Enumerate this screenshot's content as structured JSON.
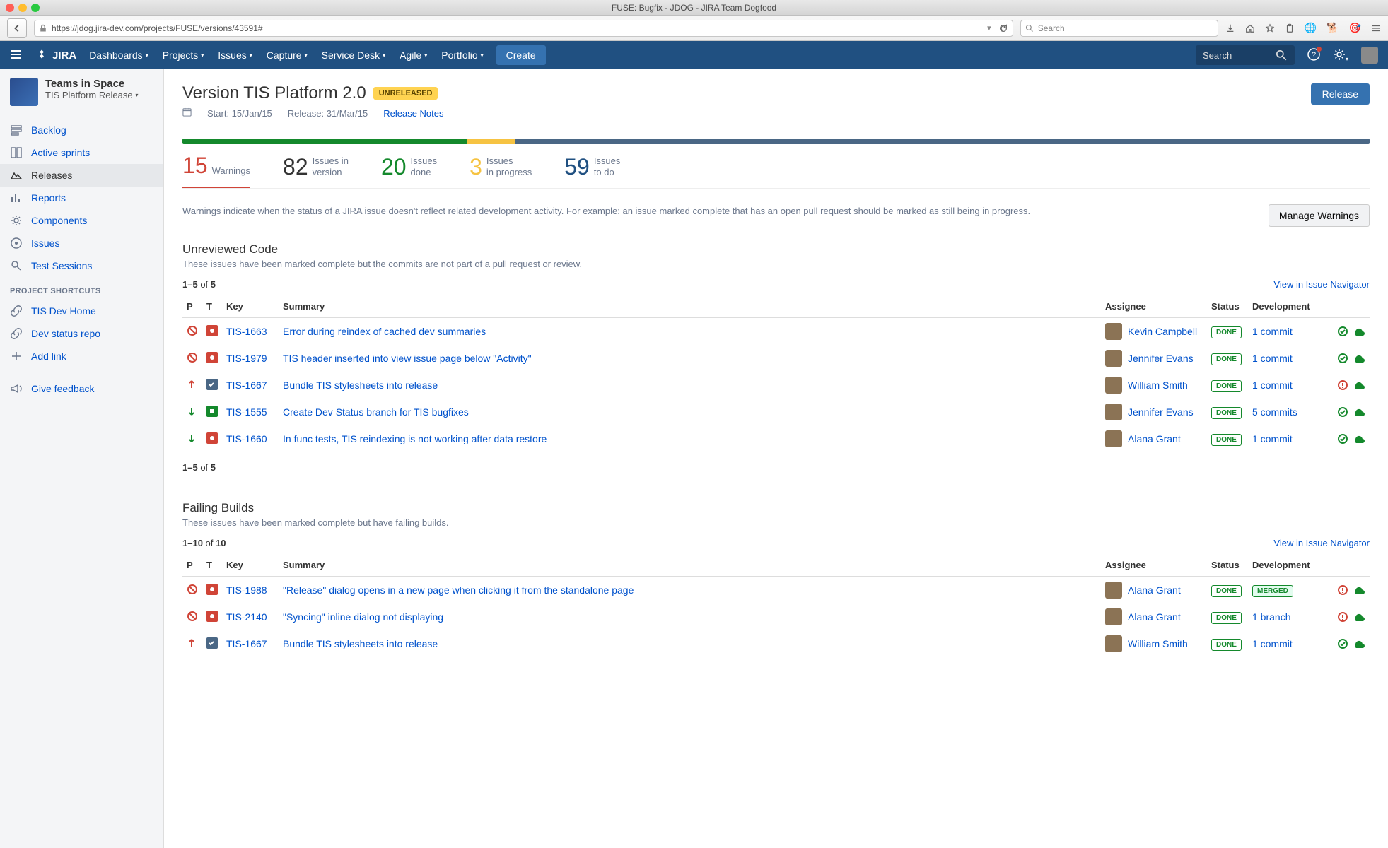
{
  "browser": {
    "title": "FUSE: Bugfix - JDOG - JIRA Team Dogfood",
    "url": "https://jdog.jira-dev.com/projects/FUSE/versions/43591#",
    "search_placeholder": "Search"
  },
  "jira_nav": {
    "items": [
      "Dashboards",
      "Projects",
      "Issues",
      "Capture",
      "Service Desk",
      "Agile",
      "Portfolio"
    ],
    "create": "Create",
    "search_placeholder": "Search"
  },
  "sidebar": {
    "project_name": "Teams in Space",
    "release_name": "TIS Platform Release",
    "nav": [
      {
        "icon": "backlog",
        "label": "Backlog"
      },
      {
        "icon": "sprints",
        "label": "Active sprints"
      },
      {
        "icon": "releases",
        "label": "Releases",
        "active": true
      },
      {
        "icon": "reports",
        "label": "Reports"
      },
      {
        "icon": "components",
        "label": "Components"
      },
      {
        "icon": "issues",
        "label": "Issues"
      },
      {
        "icon": "tests",
        "label": "Test Sessions"
      }
    ],
    "shortcuts_heading": "PROJECT SHORTCUTS",
    "shortcuts": [
      {
        "icon": "link",
        "label": "TIS Dev Home"
      },
      {
        "icon": "link",
        "label": "Dev status repo"
      },
      {
        "icon": "plus",
        "label": "Add link"
      }
    ],
    "feedback": "Give feedback"
  },
  "version": {
    "title": "Version TIS Platform 2.0",
    "badge": "UNRELEASED",
    "start_label": "Start: 15/Jan/15",
    "release_label": "Release: 31/Mar/15",
    "release_notes": "Release Notes",
    "release_btn": "Release"
  },
  "progress": {
    "green": 24,
    "yellow": 4,
    "blue": 72
  },
  "stats": {
    "warnings": {
      "num": "15",
      "label": "Warnings"
    },
    "version": {
      "num": "82",
      "label": "Issues in\nversion"
    },
    "done": {
      "num": "20",
      "label": "Issues\ndone"
    },
    "inprogress": {
      "num": "3",
      "label": "Issues\nin progress"
    },
    "todo": {
      "num": "59",
      "label": "Issues\nto do"
    }
  },
  "warnings_text": "Warnings indicate when the status of a JIRA issue doesn't reflect related development activity. For example: an issue marked complete that has an open pull request should be marked as still being in progress.",
  "manage_warnings": "Manage Warnings",
  "section1": {
    "title": "Unreviewed Code",
    "desc": "These issues have been marked complete but the commits are not part of a pull request or review.",
    "pager": "1–5 of 5",
    "pager2": "1–5 of 5",
    "navigator_link": "View in Issue Navigator",
    "headers": {
      "p": "P",
      "t": "T",
      "key": "Key",
      "summary": "Summary",
      "assignee": "Assignee",
      "status": "Status",
      "dev": "Development"
    },
    "rows": [
      {
        "p": "blocker",
        "t": "bug",
        "key": "TIS-1663",
        "summary": "Error during reindex of cached dev summaries",
        "assignee": "Kevin Campbell",
        "status": "DONE",
        "dev": "1 commit",
        "ok": true
      },
      {
        "p": "blocker",
        "t": "bug",
        "key": "TIS-1979",
        "summary": "TIS header inserted into view issue page below \"Activity\"",
        "assignee": "Jennifer Evans",
        "status": "DONE",
        "dev": "1 commit",
        "ok": true
      },
      {
        "p": "up",
        "t": "task",
        "key": "TIS-1667",
        "summary": "Bundle TIS stylesheets into release",
        "assignee": "William Smith",
        "status": "DONE",
        "dev": "1 commit",
        "ok": false
      },
      {
        "p": "down",
        "t": "improve",
        "key": "TIS-1555",
        "summary": "Create Dev Status branch for TIS bugfixes",
        "assignee": "Jennifer Evans",
        "status": "DONE",
        "dev": "5 commits",
        "ok": true
      },
      {
        "p": "down",
        "t": "bug",
        "key": "TIS-1660",
        "summary": "In func tests, TIS reindexing is not working after data restore",
        "assignee": "Alana Grant",
        "status": "DONE",
        "dev": "1 commit",
        "ok": true
      }
    ]
  },
  "section2": {
    "title": "Failing Builds",
    "desc": "These issues have been marked complete but have failing builds.",
    "pager": "1–10 of 10",
    "navigator_link": "View in Issue Navigator",
    "headers": {
      "p": "P",
      "t": "T",
      "key": "Key",
      "summary": "Summary",
      "assignee": "Assignee",
      "status": "Status",
      "dev": "Development"
    },
    "rows": [
      {
        "p": "blocker",
        "t": "bug",
        "key": "TIS-1988",
        "summary": "\"Release\" dialog opens in a new page when clicking it from the standalone page",
        "assignee": "Alana Grant",
        "status": "DONE",
        "dev": "MERGED",
        "merged": true,
        "ok": false
      },
      {
        "p": "blocker",
        "t": "bug",
        "key": "TIS-2140",
        "summary": "\"Syncing\" inline dialog not displaying",
        "assignee": "Alana Grant",
        "status": "DONE",
        "dev": "1 branch",
        "ok": false
      },
      {
        "p": "up",
        "t": "task",
        "key": "TIS-1667",
        "summary": "Bundle TIS stylesheets into release",
        "assignee": "William Smith",
        "status": "DONE",
        "dev": "1 commit",
        "ok": true
      }
    ]
  }
}
